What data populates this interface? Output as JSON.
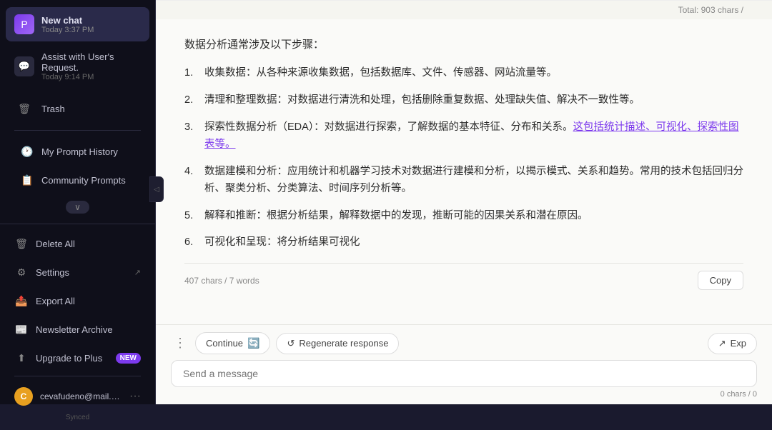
{
  "sidebar": {
    "new_chat": {
      "title": "New chat",
      "time": "Today 3:37 PM"
    },
    "assist_chat": {
      "title": "Assist with User's Request.",
      "time": "Today 9:14 PM"
    },
    "trash_label": "Trash",
    "my_prompt_history": "My Prompt History",
    "community_prompts": "Community Prompts",
    "chevron": "∨",
    "delete_all": "Delete All",
    "settings": "Settings",
    "export_all": "Export All",
    "newsletter_archive": "Newsletter Archive",
    "upgrade_to_plus": "Upgrade to Plus",
    "new_badge": "NEW",
    "user_email": "cevafudeno@mail.com",
    "synced": "Synced",
    "collapse": "◁"
  },
  "chat": {
    "intro": "数据分析通常涉及以下步骤：",
    "items": [
      {
        "number": "1.",
        "text": "收集数据：从各种来源收集数据，包括数据库、文件、传感器、网站流量等。"
      },
      {
        "number": "2.",
        "text": "清理和整理数据：对数据进行清洗和处理，包括删除重复数据、处理缺失值、解决不一致性等。"
      },
      {
        "number": "3.",
        "text": "探索性数据分析（EDA）：对数据进行探索，了解数据的基本特征、分布和关系。这包括统计描述、可视化、探索性图表等。"
      },
      {
        "number": "4.",
        "text": "数据建模和分析：应用统计和机器学习技术对数据进行建模和分析，以揭示模式、关系和趋势。常用的技术包括回归分析、聚类分析、分类算法、时间序列分析等。"
      },
      {
        "number": "5.",
        "text": "解释和推断：根据分析结果，解释数据中的发现，推断可能的因果关系和潜在原因。"
      },
      {
        "number": "6.",
        "text": "可视化和呈现：将分析结果可视化"
      }
    ],
    "char_count": "407 chars / 7 words",
    "copy_button": "Copy",
    "total_count": "Total: 903 chars /",
    "continue_btn": "Continue",
    "regenerate_btn": "Regenerate response",
    "export_btn": "Exp",
    "input_placeholder": "Send a message",
    "char_info": "0 chars / 0"
  }
}
